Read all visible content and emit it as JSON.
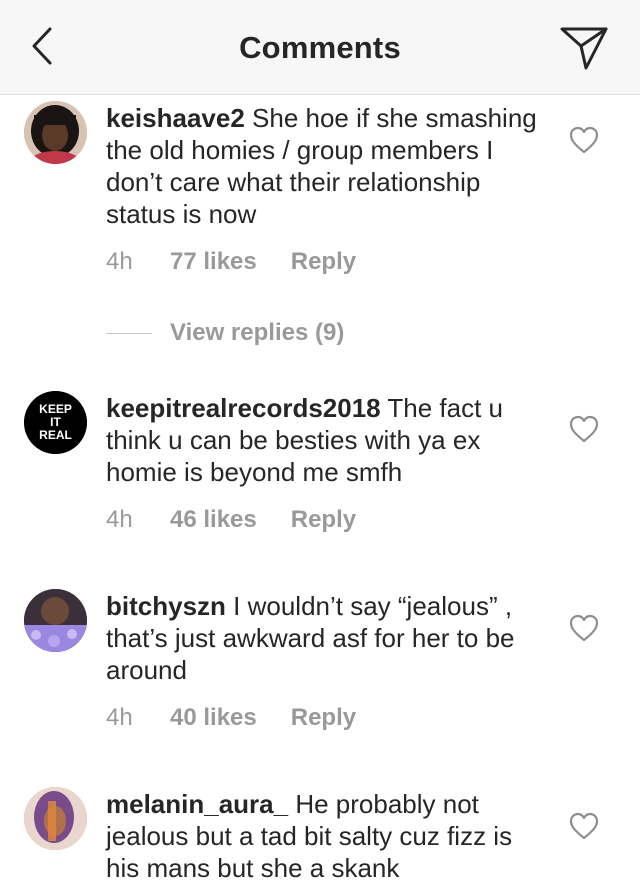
{
  "header": {
    "title": "Comments",
    "back_icon": "chevron-left-icon",
    "share_icon": "paper-plane-icon"
  },
  "colors": {
    "text": "#262626",
    "muted": "#999999",
    "header_bg": "#f7f7f7",
    "divider": "#dbdbdb"
  },
  "comments": [
    {
      "username": "keishaave2",
      "text": " She hoe if she smashing the old homies / group members I don’t care what their relationship status is now",
      "time": "4h",
      "likes": "77 likes",
      "reply": "Reply",
      "view_replies": "View replies (9)"
    },
    {
      "username": "keepitrealrecords2018",
      "text": " The fact u think u can be besties with ya ex homie is beyond me smfh",
      "time": "4h",
      "likes": "46 likes",
      "reply": "Reply",
      "avatar_logo": "KEEP IT REAL"
    },
    {
      "username": "bitchyszn",
      "text": " I wouldn’t say “jealous” , that’s just awkward asf for her to be around",
      "time": "4h",
      "likes": "40 likes",
      "reply": "Reply"
    },
    {
      "username": "melanin_aura_",
      "text": " He probably not jealous but a tad bit salty cuz fizz is his mans but she a skank"
    }
  ]
}
